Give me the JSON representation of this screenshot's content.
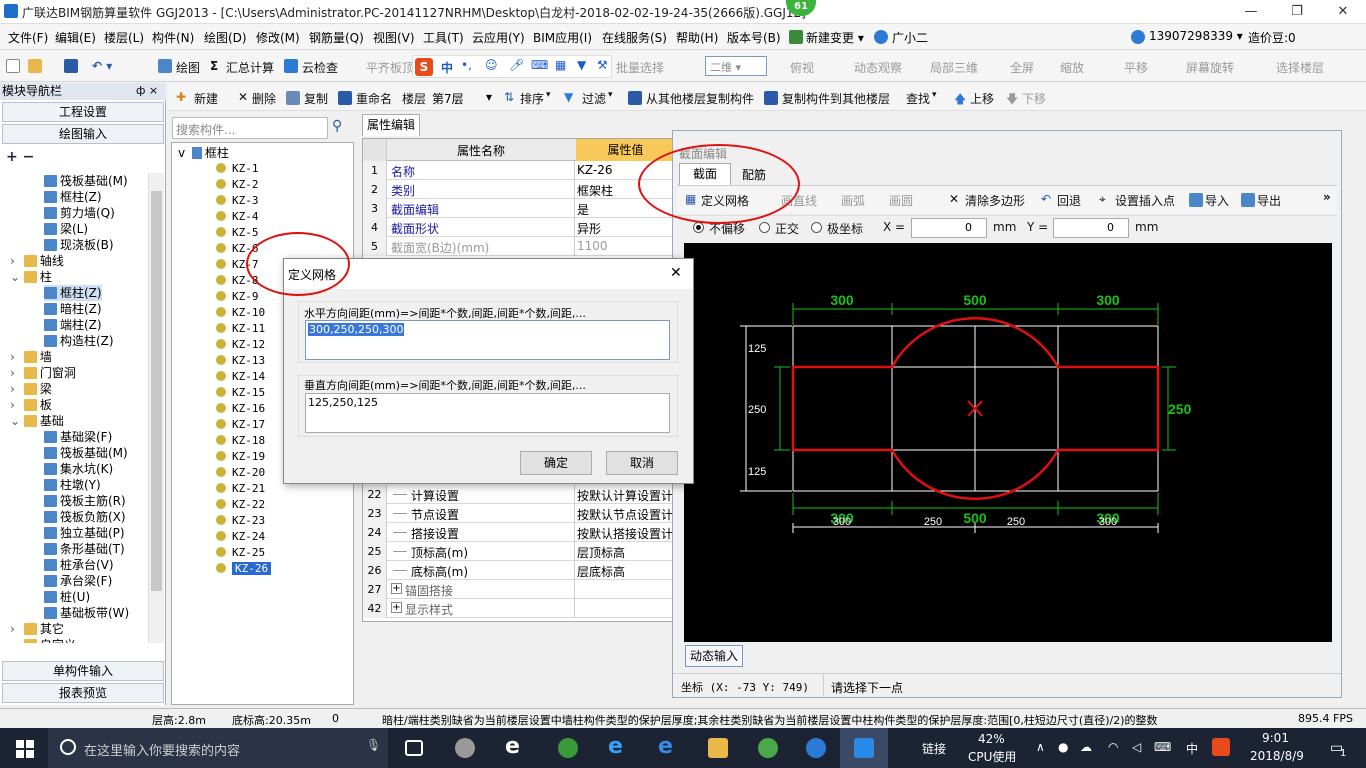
{
  "window": {
    "title": "广联达BIM钢筋算量软件 GGJ2013 - [C:\\Users\\Administrator.PC-20141127NRHM\\Desktop\\白龙村-2018-02-02-19-24-35(2666版).GGJ12]",
    "badge": "61",
    "minimize": "—",
    "restore": "❐",
    "close": "✕"
  },
  "menu": [
    "文件(F)",
    "编辑(E)",
    "楼层(L)",
    "构件(N)",
    "绘图(D)",
    "修改(M)",
    "钢筋量(Q)",
    "视图(V)",
    "工具(T)",
    "云应用(Y)",
    "BIM应用(I)",
    "在线服务(S)",
    "帮助(H)",
    "版本号(B)",
    "新建变更 ▾",
    "广小二"
  ],
  "account": {
    "phone": "13907298339 ▾",
    "cost_beans": "造价豆:0"
  },
  "toolbar1": {
    "draw": "绘图",
    "sum": "汇总计算",
    "cloud_check": "云检查",
    "flat_floor": "平齐板顶",
    "batch_select": "批量选择",
    "view_mode": "二维",
    "top_view": "俯视",
    "dynamic_view": "动态观察",
    "local_3d": "局部三维",
    "fullscreen": "全屏",
    "zoom": "缩放",
    "pan": "平移",
    "rotate": "屏幕旋转",
    "select_floor": "选择楼层",
    "ime_label": "中"
  },
  "left_panel": {
    "header": "模块导航栏",
    "pin": "ф ×",
    "project_settings": "工程设置",
    "draw_input": "绘图输入",
    "tree": [
      {
        "label": "筏板基础(M)",
        "indent": 2,
        "icon": "blue"
      },
      {
        "label": "框柱(Z)",
        "indent": 2,
        "icon": "blue"
      },
      {
        "label": "剪力墙(Q)",
        "indent": 2,
        "icon": "blue"
      },
      {
        "label": "梁(L)",
        "indent": 2,
        "icon": "blue"
      },
      {
        "label": "现浇板(B)",
        "indent": 2,
        "icon": "blue"
      },
      {
        "label": "轴线",
        "indent": 1,
        "icon": "folder",
        "exp": ">"
      },
      {
        "label": "柱",
        "indent": 1,
        "icon": "folder",
        "exp": "v"
      },
      {
        "label": "框柱(Z)",
        "indent": 2,
        "icon": "blue",
        "selected": true
      },
      {
        "label": "暗柱(Z)",
        "indent": 2,
        "icon": "blue"
      },
      {
        "label": "端柱(Z)",
        "indent": 2,
        "icon": "blue"
      },
      {
        "label": "构造柱(Z)",
        "indent": 2,
        "icon": "blue"
      },
      {
        "label": "墙",
        "indent": 1,
        "icon": "folder",
        "exp": ">"
      },
      {
        "label": "门窗洞",
        "indent": 1,
        "icon": "folder",
        "exp": ">"
      },
      {
        "label": "梁",
        "indent": 1,
        "icon": "folder",
        "exp": ">"
      },
      {
        "label": "板",
        "indent": 1,
        "icon": "folder",
        "exp": ">"
      },
      {
        "label": "基础",
        "indent": 1,
        "icon": "folder",
        "exp": "v"
      },
      {
        "label": "基础梁(F)",
        "indent": 2,
        "icon": "blue"
      },
      {
        "label": "筏板基础(M)",
        "indent": 2,
        "icon": "blue"
      },
      {
        "label": "集水坑(K)",
        "indent": 2,
        "icon": "blue"
      },
      {
        "label": "柱墩(Y)",
        "indent": 2,
        "icon": "blue"
      },
      {
        "label": "筏板主筋(R)",
        "indent": 2,
        "icon": "blue"
      },
      {
        "label": "筏板负筋(X)",
        "indent": 2,
        "icon": "blue"
      },
      {
        "label": "独立基础(P)",
        "indent": 2,
        "icon": "blue"
      },
      {
        "label": "条形基础(T)",
        "indent": 2,
        "icon": "blue"
      },
      {
        "label": "桩承台(V)",
        "indent": 2,
        "icon": "blue"
      },
      {
        "label": "承台梁(F)",
        "indent": 2,
        "icon": "blue"
      },
      {
        "label": "桩(U)",
        "indent": 2,
        "icon": "blue"
      },
      {
        "label": "基础板带(W)",
        "indent": 2,
        "icon": "blue"
      },
      {
        "label": "其它",
        "indent": 1,
        "icon": "folder",
        "exp": ">"
      },
      {
        "label": "自定义",
        "indent": 1,
        "icon": "folder",
        "exp": "v"
      }
    ],
    "single_input": "单构件输入",
    "report_preview": "报表预览"
  },
  "toolbar2": {
    "new": "新建",
    "delete": "删除",
    "copy": "复制",
    "rename": "重命名",
    "floor_label": "楼层",
    "floor_value": "第7层",
    "sort": "排序",
    "filter": "过滤",
    "copy_from": "从其他楼层复制构件",
    "copy_to": "复制构件到其他楼层",
    "find": "查找",
    "up": "上移",
    "down": "下移"
  },
  "comp_tree": {
    "search_placeholder": "搜索构件...",
    "root": "框柱",
    "items": [
      "KZ-1",
      "KZ-2",
      "KZ-3",
      "KZ-4",
      "KZ-5",
      "KZ-6",
      "KZ-7",
      "KZ-8",
      "KZ-9",
      "KZ-10",
      "KZ-11",
      "KZ-12",
      "KZ-13",
      "KZ-14",
      "KZ-15",
      "KZ-16",
      "KZ-17",
      "KZ-18",
      "KZ-19",
      "KZ-20",
      "KZ-21",
      "KZ-22",
      "KZ-23",
      "KZ-24",
      "KZ-25",
      "KZ-26"
    ],
    "selected": "KZ-26"
  },
  "properties": {
    "tab": "属性编辑",
    "col_name": "属性名称",
    "col_value": "属性值",
    "rows_top": [
      {
        "n": "1",
        "name": "名称",
        "value": "KZ-26"
      },
      {
        "n": "2",
        "name": "类别",
        "value": "框架柱"
      },
      {
        "n": "3",
        "name": "截面编辑",
        "value": "是"
      },
      {
        "n": "4",
        "name": "截面形状",
        "value": "异形"
      },
      {
        "n": "5",
        "name": "截面宽(B边)(mm)",
        "value": "1100"
      }
    ],
    "rows_bottom": [
      {
        "n": "22",
        "name": "计算设置",
        "value": "按默认计算设置计"
      },
      {
        "n": "23",
        "name": "节点设置",
        "value": "按默认节点设置计"
      },
      {
        "n": "24",
        "name": "搭接设置",
        "value": "按默认搭接设置计"
      },
      {
        "n": "25",
        "name": "顶标高(m)",
        "value": "层顶标高"
      },
      {
        "n": "26",
        "name": "底标高(m)",
        "value": "层底标高"
      },
      {
        "n": "27",
        "name": "锚固搭接",
        "value": "",
        "plus": "+"
      },
      {
        "n": "42",
        "name": "显示样式",
        "value": "",
        "plus": "+"
      }
    ]
  },
  "section_editor": {
    "title": "截面编辑",
    "tabs": [
      "截面",
      "配筋"
    ],
    "tools": {
      "define_grid": "定义网格",
      "line": "画直线",
      "arc": "画弧",
      "circle": "画圆",
      "clear_poly": "清除多边形",
      "undo": "回退",
      "set_insert": "设置插入点",
      "import": "导入",
      "export": "导出"
    },
    "mode": {
      "no_offset": "不偏移",
      "ortho": "正交",
      "polar": "极坐标"
    },
    "x_label": "X =",
    "x_value": "0",
    "y_label": "Y =",
    "y_value": "0",
    "unit": "mm",
    "dynamic_input": "动态输入",
    "coord": "坐标 (X: -73 Y: 749)",
    "prompt": "请选择下一点",
    "dims": {
      "top": [
        "300",
        "500",
        "300"
      ],
      "bottom_green": [
        "300",
        "500",
        "300"
      ],
      "bottom_white": [
        "300",
        "250",
        "250",
        "300"
      ],
      "left": [
        "125",
        "250",
        "125"
      ],
      "right": "250"
    },
    "colors": {
      "grid": "#ffffff",
      "shape": "#e01010",
      "dim": "#18c018"
    }
  },
  "dialog": {
    "title": "定义网格",
    "close": "✕",
    "h_label": "水平方向间距(mm)=>间距*个数,间距,间距*个数,间距,...",
    "h_value": "300,250,250,300",
    "v_label": "垂直方向间距(mm)=>间距*个数,间距,间距*个数,间距,...",
    "v_value": "125,250,125",
    "ok": "确定",
    "cancel": "取消"
  },
  "status": {
    "floor_height": "层高:2.8m",
    "base_elev": "底标高:20.35m",
    "zero": "0",
    "message": "暗柱/端柱类别缺省为当前楼层设置中墙柱构件类型的保护层厚度;其余柱类别缺省为当前楼层设置中柱构件类型的保护层厚度:范围[0,柱短边尺寸(直径)/2)的整数",
    "fps": "895.4 FPS"
  },
  "taskbar": {
    "search_placeholder": "在这里输入你要搜索的内容",
    "link": "链接",
    "cpu_pct": "42%",
    "cpu_label": "CPU使用",
    "ime": "中",
    "time": "9:01",
    "date": "2018/8/9",
    "notif": "1"
  }
}
